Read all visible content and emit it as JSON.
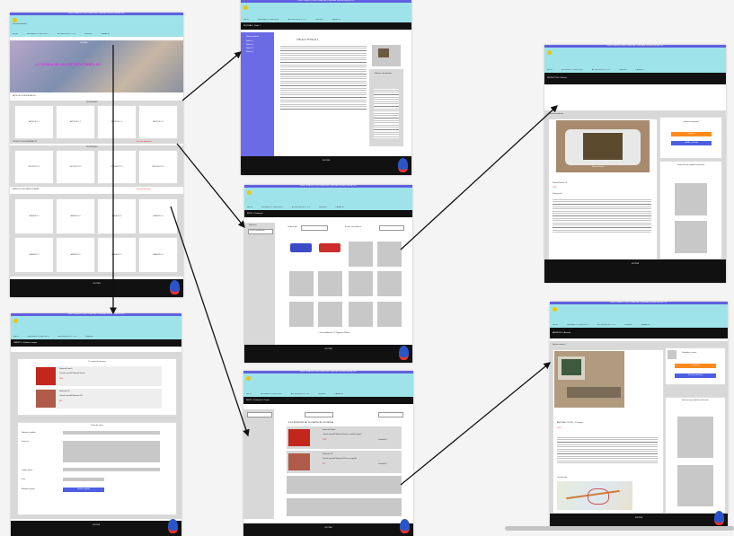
{
  "frames": {
    "home": {
      "topbar": "ENVÍO GRATUITO EN TODAS LAS COMPRAS SUPERIORES A 150€",
      "logo_caption": "Los retroconsolas",
      "nav": [
        "INICIO",
        "NINTENDO 1 PLAY SOLO",
        "ACCESORIOS 5 Y 5 F",
        "VENDER",
        "CAMBIOS"
      ],
      "hero_title": "HOLIDAY",
      "hero_text": "LA TIENDA DE LAS RETROCONSOLAS",
      "sec1_title": "ARTÍCULOS DESTACADOS",
      "sec1_sub": "NOVEDADES",
      "articles": [
        "ARTÍCULO 1",
        "ARTÍCULO 2",
        "ARTÍCULO 3",
        "ARTÍCULO 4"
      ],
      "sec2_title": "PRODUCTOS DESTACADOS",
      "sec2_sub": "NOVEDADES",
      "sec2_link": "Ver más productos",
      "products": [
        "PRODUCTO 1",
        "PRODUCTO 2",
        "PRODUCTO 3",
        "PRODUCTO 4"
      ],
      "sec3_title": "ANUNCIOS DE PARTICULARES",
      "sec3_link": "Ver más anuncios",
      "ads": [
        "ANUNCIO 1",
        "ANUNCIO 2",
        "ANUNCIO 3",
        "ANUNCIO 4",
        "ANUNCIO 5",
        "ANUNCIO 6",
        "ANUNCIO 7",
        "ANUNCIO 8"
      ],
      "footer": "FOOTER"
    },
    "article": {
      "topbar": "ENVÍO GRATUITO EN TODAS LAS COMPRAS SUPERIORES A 150€",
      "breadcrumb": "NOTICIAS > Titular 1",
      "side_title": "Últimas noticias",
      "side_items": [
        "Noticia 1",
        "Noticia 2",
        "Noticia 3",
        "Noticia 4"
      ],
      "title": "TÍTULO TITULO 1",
      "box_title": "Noticias relacionadas",
      "footer": "FOOTER"
    },
    "catalog": {
      "topbar": "ENVÍO GRATUITO EN TODAS LAS COMPRAS SUPERIORES A 150€",
      "breadcrumb": "INICIO > Productos",
      "filter_label": "Filtrar por",
      "filter_value": "Precio ascendente",
      "sort_label": "Ordenar por",
      "search_label": "Buscar en productos",
      "pager": "< Primera Anterior 1 2 Siguiente Última >",
      "footer": "FOOTER"
    },
    "cart": {
      "topbar": "ENVÍO GRATUITO EN TODAS LAS COMPRAS SUPERIORES A 150€",
      "breadcrumb": "INICIO > Productos > Carrito",
      "title": "Los artículos en tu carrito de compras",
      "items": [
        {
          "name": "Nintendo Switch",
          "desc": "Consola portátil Nintendo Switch, modelo original",
          "price": "200€",
          "qty": "Cantidad: 1"
        },
        {
          "name": "Nintendo DS",
          "desc": "Consola portátil Nintendo DS con cargador",
          "price": "80€",
          "qty": "Cantidad: 1"
        }
      ],
      "footer": "FOOTER"
    },
    "checkout": {
      "topbar": "ENVÍO GRATUITO EN TODAS LAS COMPRAS SUPERIORES A 150€",
      "breadcrumb": "CARRITO > Finalizar compra",
      "summary_title": "Tu carrito de compras",
      "items": [
        {
          "name": "Nintendo Switch",
          "desc": "Consola portátil Nintendo Switch",
          "price": "200€"
        },
        {
          "name": "Nintendo DS",
          "desc": "Consola portátil Nintendo DS",
          "price": "80€"
        }
      ],
      "form_title": "Datos de envío",
      "fields": [
        "Nombre completo",
        "Dirección",
        "Código postal",
        "País",
        "Método de pago"
      ],
      "submit": "Realizar pedido",
      "footer": "FOOTER"
    },
    "product": {
      "topbar": "ENVÍO GRATUITO EN TODAS LAS COMPRAS SUPERIORES A 150€",
      "breadcrumb": "PRODUCTOS > Retroid",
      "section_title": "Mostrar productos",
      "caption": "Retroid Pocket",
      "name": "Retroid Pocket 2S",
      "price": "150€",
      "desc_title": "Descripción",
      "buy_title": "¿Quieres comprarlo?",
      "btn_primary": "Comprar",
      "btn_secondary": "Añadir al carrito",
      "related_title": "Productos que podrían interesarte",
      "footer": "FOOTER"
    },
    "listing": {
      "topbar": "ENVÍO GRATUITO EN TODAS LAS COMPRAS SUPERIORES A 150€",
      "breadcrumb": "ANUNCIOS > Amstrad",
      "section_title": "Mostrar anuncio",
      "name": "AMSTRAD CPC464 + 20 juegos",
      "price": "120€",
      "contact_title": "Vendedor: usuario",
      "btn_primary": "Contactar",
      "btn_secondary": "Ver más anuncios",
      "map_label": "Localización",
      "related_title": "Anuncios que podrían interesarte",
      "footer": "FOOTER"
    }
  },
  "colors": {
    "header": "#9ee3ea",
    "topbar": "#6060e0",
    "sidebar": "#6b6be6",
    "orange": "#ff8a1a",
    "blue": "#4d5fe0",
    "price_red": "#e23"
  }
}
